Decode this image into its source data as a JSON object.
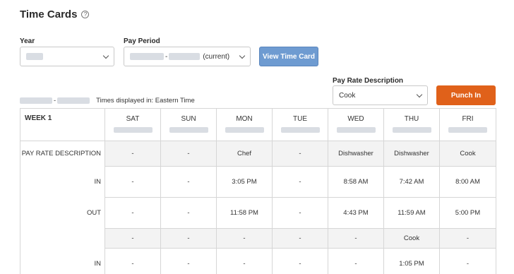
{
  "page": {
    "title": "Time Cards",
    "help_icon": "question-circle-icon"
  },
  "filters": {
    "year_label": "Year",
    "pay_period_label": "Pay Period",
    "pay_period_separator": "-",
    "pay_period_suffix": "(current)",
    "view_button": "View Time Card"
  },
  "pay_rate": {
    "label": "Pay Rate Description",
    "selected": "Cook",
    "punch_button": "Punch In"
  },
  "range": {
    "separator": "-",
    "timezone_note": "Times displayed in: Eastern Time"
  },
  "timecard": {
    "week_label": "WEEK 1",
    "days": [
      "SAT",
      "SUN",
      "MON",
      "TUE",
      "WED",
      "THU",
      "FRI"
    ],
    "rows": [
      {
        "label": "PAY RATE DESCRIPTION",
        "shade": true,
        "cells": [
          "-",
          "-",
          "Chef",
          "-",
          "Dishwasher",
          "Dishwasher",
          "Cook"
        ]
      },
      {
        "label": "IN",
        "shade": false,
        "cells": [
          "-",
          "-",
          "3:05 PM",
          "-",
          "8:58 AM",
          "7:42 AM",
          "8:00 AM"
        ]
      },
      {
        "label": "OUT",
        "shade": false,
        "cells": [
          "-",
          "-",
          "11:58 PM",
          "-",
          "4:43 PM",
          "11:59 AM",
          "5:00 PM"
        ]
      },
      {
        "label": "",
        "shade": true,
        "cells": [
          "-",
          "-",
          "-",
          "-",
          "-",
          "Cook",
          "-"
        ]
      },
      {
        "label": "IN",
        "shade": false,
        "cells": [
          "-",
          "-",
          "-",
          "-",
          "-",
          "1:05 PM",
          "-"
        ]
      }
    ]
  },
  "colors": {
    "primary_button": "#6e9bd1",
    "punch_button": "#e0611a"
  }
}
